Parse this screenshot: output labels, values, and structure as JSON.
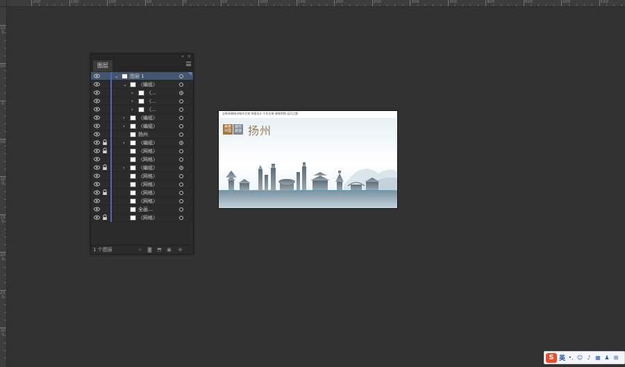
{
  "rulers": {
    "top_labels": [
      "250",
      "150",
      "100",
      "50",
      "0",
      "50",
      "100",
      "150",
      "200",
      "250",
      "300",
      "350",
      "400",
      "450",
      "500",
      "550"
    ],
    "left_labels": [
      "100",
      "50",
      "0",
      "50",
      "100",
      "150",
      "200",
      "250",
      "300"
    ]
  },
  "layers_panel": {
    "tab_label": "图层",
    "collapse_glyph": "«",
    "close_glyph": "×",
    "footer_count": "1 个图层",
    "rows": [
      {
        "name": "图层 1",
        "selected": true,
        "locked": false,
        "chevron": "⌄",
        "target": "ring"
      },
      {
        "name": "〈编组〉",
        "selected": false,
        "locked": false,
        "chevron": "⌄",
        "target": "ring"
      },
      {
        "name": "〈...",
        "selected": false,
        "locked": false,
        "chevron": "›",
        "target": "filled"
      },
      {
        "name": "〈...",
        "selected": false,
        "locked": false,
        "chevron": "›",
        "target": "ring"
      },
      {
        "name": "〈...",
        "selected": false,
        "locked": false,
        "chevron": "›",
        "target": "ring"
      },
      {
        "name": "〈编组〉",
        "selected": false,
        "locked": false,
        "chevron": "›",
        "target": "ring"
      },
      {
        "name": "〈编组〉",
        "selected": false,
        "locked": false,
        "chevron": "›",
        "target": "ring"
      },
      {
        "name": "扬州",
        "selected": false,
        "locked": false,
        "chevron": "",
        "target": "ring"
      },
      {
        "name": "〈编组〉",
        "selected": false,
        "locked": true,
        "chevron": "›",
        "target": "filled"
      },
      {
        "name": "〈网格〉",
        "selected": false,
        "locked": true,
        "chevron": "",
        "target": "ring"
      },
      {
        "name": "〈网格〉",
        "selected": false,
        "locked": false,
        "chevron": "",
        "target": "ring"
      },
      {
        "name": "〈编组〉",
        "selected": false,
        "locked": true,
        "chevron": "›",
        "target": "filled"
      },
      {
        "name": "〈网格〉",
        "selected": false,
        "locked": false,
        "chevron": "",
        "target": "ring"
      },
      {
        "name": "〈网格〉",
        "selected": false,
        "locked": false,
        "chevron": "",
        "target": "ring"
      },
      {
        "name": "〈网格〉",
        "selected": false,
        "locked": true,
        "chevron": "",
        "target": "ring"
      },
      {
        "name": "〈网格〉",
        "selected": false,
        "locked": false,
        "chevron": "",
        "target": "ring"
      },
      {
        "name": "全画...",
        "selected": false,
        "locked": false,
        "chevron": "",
        "target": "ring"
      },
      {
        "name": "〈网格〉",
        "selected": false,
        "locked": true,
        "chevron": "",
        "target": "ring"
      }
    ]
  },
  "artboard": {
    "subtitle": "全新高端扬州城市文旅 海报设计 千年古城 璀璨明珠 运河之都",
    "stamp_left": "美丽中国",
    "stamp_right": "城市旅游",
    "city_name": "扬州",
    "colors": {
      "stamp_left": "#a8743a",
      "stamp_right": "#7d8a93",
      "city": "#9a7a5a"
    }
  },
  "ime": {
    "logo": "S",
    "lang": "英",
    "icons": [
      "punct-icon",
      "emoji-icon",
      "mic-icon",
      "keyboard-icon",
      "user-icon",
      "grid-icon"
    ]
  }
}
